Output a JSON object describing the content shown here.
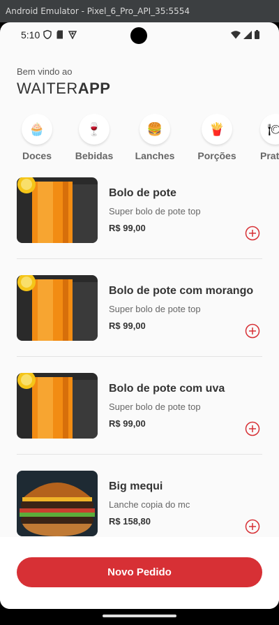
{
  "window": {
    "title": "Android Emulator - Pixel_6_Pro_API_35:5554"
  },
  "status_bar": {
    "time": "5:10"
  },
  "header": {
    "greeting": "Bem vindo ao",
    "brand_light": "WAITER",
    "brand_bold": "APP"
  },
  "categories": [
    {
      "label": "Doces",
      "icon": "cupcake-icon",
      "glyph": "🧁"
    },
    {
      "label": "Bebidas",
      "icon": "wine-glass-icon",
      "glyph": "🍷"
    },
    {
      "label": "Lanches",
      "icon": "burger-icon",
      "glyph": "🍔"
    },
    {
      "label": "Porções",
      "icon": "fries-icon",
      "glyph": "🍟"
    },
    {
      "label": "Pratos",
      "icon": "plate-icon",
      "glyph": "🍽"
    }
  ],
  "products": [
    {
      "name": "Bolo de pote",
      "description": "Super bolo de pote top",
      "price": "R$ 99,00",
      "image": "orange-juice-image"
    },
    {
      "name": "Bolo de pote com morango",
      "description": "Super bolo de pote top",
      "price": "R$ 99,00",
      "image": "orange-juice-image"
    },
    {
      "name": "Bolo de pote com uva",
      "description": "Super bolo de pote top",
      "price": "R$ 99,00",
      "image": "orange-juice-image"
    },
    {
      "name": "Big mequi",
      "description": "Lanche copia do mc",
      "price": "R$ 158,80",
      "image": "burger-image"
    }
  ],
  "footer": {
    "button_label": "Novo Pedido"
  },
  "colors": {
    "accent": "#d73035",
    "background": "#fafafa",
    "text": "#333333"
  }
}
